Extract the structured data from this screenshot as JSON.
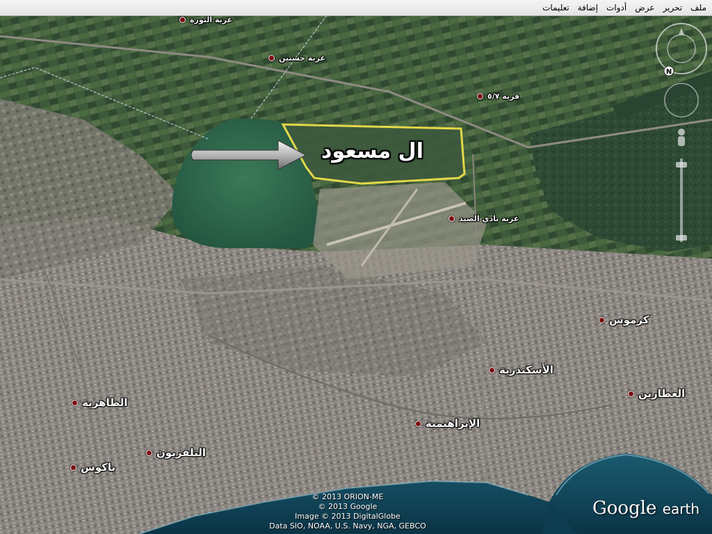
{
  "menu": {
    "items": [
      "ملف",
      "تحرير",
      "عرض",
      "أدوات",
      "إضافة",
      "تعليمات"
    ]
  },
  "map": {
    "highlight_label": "ال مسعود",
    "places": [
      {
        "id": "izbet-althawra",
        "label": "عزبة الثورة",
        "size": "small"
      },
      {
        "id": "izbet-hassanein",
        "label": "عزبة حسنين",
        "size": "small"
      },
      {
        "id": "qaryat-5-7",
        "label": "قرية ٥/٧",
        "size": "small"
      },
      {
        "id": "izbet-nadi-alsaid",
        "label": "عزبة نادي الصيد",
        "size": "small"
      },
      {
        "id": "karmous",
        "label": "كرموس",
        "size": "big"
      },
      {
        "id": "alexandria",
        "label": "الأسكندرية",
        "size": "big"
      },
      {
        "id": "zahriya",
        "label": "الظاهرية",
        "size": "big"
      },
      {
        "id": "attarin",
        "label": "العطارين",
        "size": "big"
      },
      {
        "id": "ibrahimiya",
        "label": "الإبراهيمية",
        "size": "big"
      },
      {
        "id": "telephone",
        "label": "التلفزيون",
        "size": "big"
      },
      {
        "id": "bacos",
        "label": "باكوس",
        "size": "big"
      }
    ],
    "attribution": [
      "© 2013 ORION-ME",
      "© 2013 Google",
      "Image © 2013 DigitalGlobe",
      "Data SIO, NOAA, U.S. Navy, NGA, GEBCO"
    ],
    "logo": {
      "brand": "Google",
      "suffix": "earth"
    },
    "compass_letter": "N",
    "colors": {
      "highlight_border": "#f2e34a",
      "pin": "#7a0f12",
      "sea": "#0f3e52",
      "lake": "#2f6a4c"
    }
  }
}
